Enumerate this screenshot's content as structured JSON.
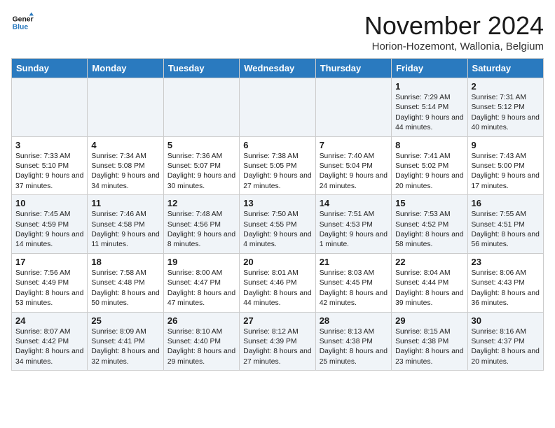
{
  "logo": {
    "line1": "General",
    "line2": "Blue"
  },
  "header": {
    "month_year": "November 2024",
    "location": "Horion-Hozemont, Wallonia, Belgium"
  },
  "weekdays": [
    "Sunday",
    "Monday",
    "Tuesday",
    "Wednesday",
    "Thursday",
    "Friday",
    "Saturday"
  ],
  "weeks": [
    [
      {
        "day": "",
        "info": ""
      },
      {
        "day": "",
        "info": ""
      },
      {
        "day": "",
        "info": ""
      },
      {
        "day": "",
        "info": ""
      },
      {
        "day": "",
        "info": ""
      },
      {
        "day": "1",
        "info": "Sunrise: 7:29 AM\nSunset: 5:14 PM\nDaylight: 9 hours and 44 minutes."
      },
      {
        "day": "2",
        "info": "Sunrise: 7:31 AM\nSunset: 5:12 PM\nDaylight: 9 hours and 40 minutes."
      }
    ],
    [
      {
        "day": "3",
        "info": "Sunrise: 7:33 AM\nSunset: 5:10 PM\nDaylight: 9 hours and 37 minutes."
      },
      {
        "day": "4",
        "info": "Sunrise: 7:34 AM\nSunset: 5:08 PM\nDaylight: 9 hours and 34 minutes."
      },
      {
        "day": "5",
        "info": "Sunrise: 7:36 AM\nSunset: 5:07 PM\nDaylight: 9 hours and 30 minutes."
      },
      {
        "day": "6",
        "info": "Sunrise: 7:38 AM\nSunset: 5:05 PM\nDaylight: 9 hours and 27 minutes."
      },
      {
        "day": "7",
        "info": "Sunrise: 7:40 AM\nSunset: 5:04 PM\nDaylight: 9 hours and 24 minutes."
      },
      {
        "day": "8",
        "info": "Sunrise: 7:41 AM\nSunset: 5:02 PM\nDaylight: 9 hours and 20 minutes."
      },
      {
        "day": "9",
        "info": "Sunrise: 7:43 AM\nSunset: 5:00 PM\nDaylight: 9 hours and 17 minutes."
      }
    ],
    [
      {
        "day": "10",
        "info": "Sunrise: 7:45 AM\nSunset: 4:59 PM\nDaylight: 9 hours and 14 minutes."
      },
      {
        "day": "11",
        "info": "Sunrise: 7:46 AM\nSunset: 4:58 PM\nDaylight: 9 hours and 11 minutes."
      },
      {
        "day": "12",
        "info": "Sunrise: 7:48 AM\nSunset: 4:56 PM\nDaylight: 9 hours and 8 minutes."
      },
      {
        "day": "13",
        "info": "Sunrise: 7:50 AM\nSunset: 4:55 PM\nDaylight: 9 hours and 4 minutes."
      },
      {
        "day": "14",
        "info": "Sunrise: 7:51 AM\nSunset: 4:53 PM\nDaylight: 9 hours and 1 minute."
      },
      {
        "day": "15",
        "info": "Sunrise: 7:53 AM\nSunset: 4:52 PM\nDaylight: 8 hours and 58 minutes."
      },
      {
        "day": "16",
        "info": "Sunrise: 7:55 AM\nSunset: 4:51 PM\nDaylight: 8 hours and 56 minutes."
      }
    ],
    [
      {
        "day": "17",
        "info": "Sunrise: 7:56 AM\nSunset: 4:49 PM\nDaylight: 8 hours and 53 minutes."
      },
      {
        "day": "18",
        "info": "Sunrise: 7:58 AM\nSunset: 4:48 PM\nDaylight: 8 hours and 50 minutes."
      },
      {
        "day": "19",
        "info": "Sunrise: 8:00 AM\nSunset: 4:47 PM\nDaylight: 8 hours and 47 minutes."
      },
      {
        "day": "20",
        "info": "Sunrise: 8:01 AM\nSunset: 4:46 PM\nDaylight: 8 hours and 44 minutes."
      },
      {
        "day": "21",
        "info": "Sunrise: 8:03 AM\nSunset: 4:45 PM\nDaylight: 8 hours and 42 minutes."
      },
      {
        "day": "22",
        "info": "Sunrise: 8:04 AM\nSunset: 4:44 PM\nDaylight: 8 hours and 39 minutes."
      },
      {
        "day": "23",
        "info": "Sunrise: 8:06 AM\nSunset: 4:43 PM\nDaylight: 8 hours and 36 minutes."
      }
    ],
    [
      {
        "day": "24",
        "info": "Sunrise: 8:07 AM\nSunset: 4:42 PM\nDaylight: 8 hours and 34 minutes."
      },
      {
        "day": "25",
        "info": "Sunrise: 8:09 AM\nSunset: 4:41 PM\nDaylight: 8 hours and 32 minutes."
      },
      {
        "day": "26",
        "info": "Sunrise: 8:10 AM\nSunset: 4:40 PM\nDaylight: 8 hours and 29 minutes."
      },
      {
        "day": "27",
        "info": "Sunrise: 8:12 AM\nSunset: 4:39 PM\nDaylight: 8 hours and 27 minutes."
      },
      {
        "day": "28",
        "info": "Sunrise: 8:13 AM\nSunset: 4:38 PM\nDaylight: 8 hours and 25 minutes."
      },
      {
        "day": "29",
        "info": "Sunrise: 8:15 AM\nSunset: 4:38 PM\nDaylight: 8 hours and 23 minutes."
      },
      {
        "day": "30",
        "info": "Sunrise: 8:16 AM\nSunset: 4:37 PM\nDaylight: 8 hours and 20 minutes."
      }
    ]
  ]
}
